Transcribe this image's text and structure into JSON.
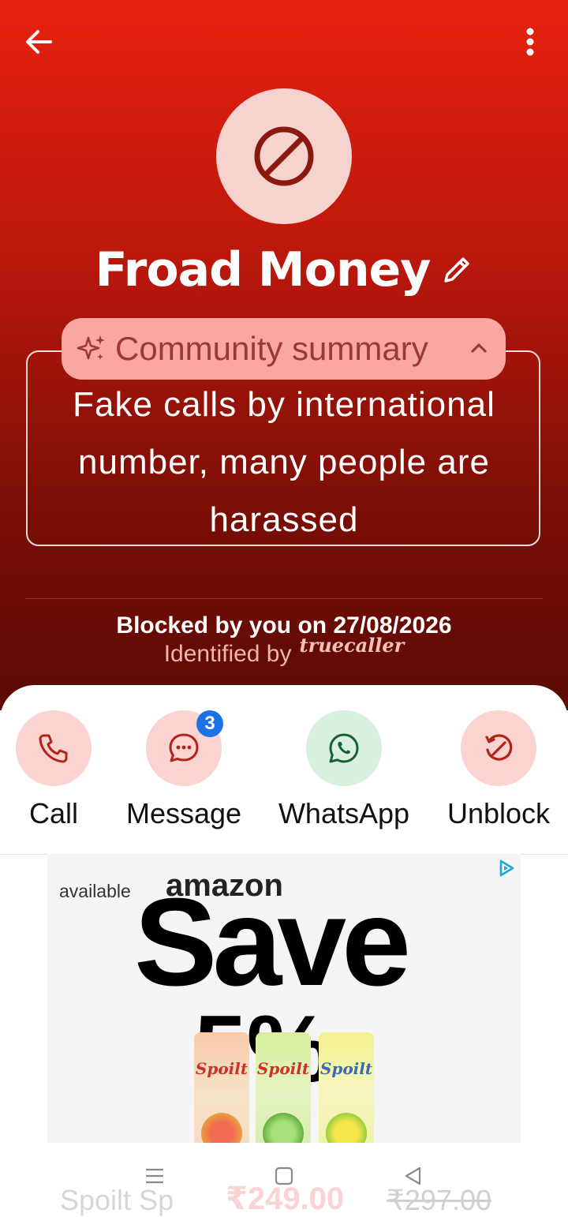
{
  "contact": {
    "name": "Froad Money"
  },
  "summary": {
    "label": "Community summary",
    "text": "Fake calls by international number, many people are harassed"
  },
  "status": {
    "blocked": "Blocked by you on 27/08/2026",
    "identified_prefix": "Identified by",
    "identified_brand": "truecaller"
  },
  "actions": [
    {
      "label": "Call",
      "icon": "phone-icon"
    },
    {
      "label": "Message",
      "icon": "message-icon",
      "badge": "3"
    },
    {
      "label": "WhatsApp",
      "icon": "whatsapp-icon"
    },
    {
      "label": "Unblock",
      "icon": "unblock-icon"
    }
  ],
  "ad": {
    "available": "available",
    "amazon": "amazon",
    "headline": "Save",
    "percent": "5%",
    "brand": "Spoilt",
    "product": "Spoilt Sp",
    "price": "₹249.00",
    "mrp": "₹297.00"
  },
  "colors": {
    "header_top": "#e8210f",
    "header_bottom": "#5a0a04",
    "pill": "#fba7a1",
    "badge": "#1c73e8",
    "whatsapp_bg": "#d7f0e0"
  }
}
